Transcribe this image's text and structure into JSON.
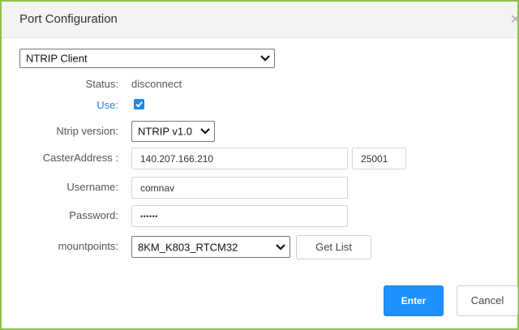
{
  "dialog": {
    "title": "Port Configuration",
    "close_icon": "close-icon"
  },
  "port_type": {
    "selected": "NTRIP Client"
  },
  "form": {
    "status_label": "Status:",
    "status_value": "disconnect",
    "use_label": "Use:",
    "use_checked": true,
    "ntrip_version_label": "Ntrip version:",
    "ntrip_version_selected": "NTRIP v1.0",
    "caster_address_label": "CasterAddress :",
    "caster_address_value": "140.207.166.210",
    "caster_port_value": "25001",
    "username_label": "Username:",
    "username_value": "comnav",
    "password_label": "Password:",
    "password_value": "••••••",
    "mountpoints_label": "mountpoints:",
    "mountpoints_selected": "8KM_K803_RTCM32"
  },
  "buttons": {
    "get_list": "Get List",
    "enter": "Enter",
    "cancel": "Cancel"
  },
  "colors": {
    "border_accent": "#8bc34a",
    "primary": "#1e90ff",
    "use_label": "#2a7fd4"
  }
}
